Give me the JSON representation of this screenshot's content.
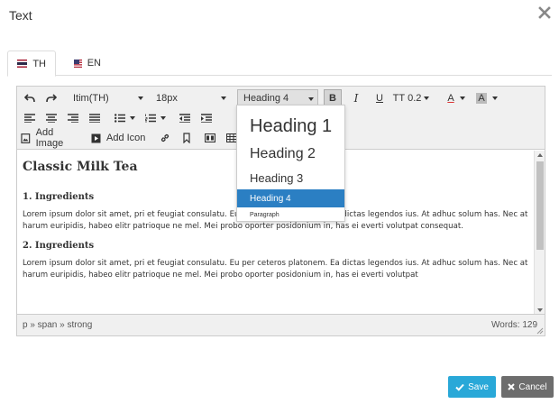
{
  "dialog": {
    "title": "Text"
  },
  "tabs": [
    {
      "label": "TH",
      "icon": "thai-flag-icon",
      "active": true
    },
    {
      "label": "EN",
      "icon": "us-flag-icon",
      "active": false
    }
  ],
  "toolbar": {
    "font_family": "Itim(TH)",
    "font_size": "18px",
    "format": "Heading 4",
    "line_height": "0.2",
    "add_image_label": "Add Image",
    "add_icon_label": "Add Icon",
    "text_color_label": "A",
    "bg_color_label": "A",
    "bold_label": "B",
    "italic_label": "I",
    "underline_label": "U",
    "line_height_label": "TT"
  },
  "format_dropdown": {
    "items": [
      "Heading 1",
      "Heading 2",
      "Heading 3",
      "Heading 4",
      "Paragraph"
    ],
    "selected": "Heading 4",
    "selected_color": "#2b7fc3"
  },
  "content": {
    "title": "Classic Milk Tea",
    "sections": [
      {
        "heading": "1. Ingredients",
        "body": "Lorem ipsum dolor sit amet, pri et feugiat consulatu. Eu per ceteros platonem. Ea dictas legendos ius. At adhuc solum has. Nec at harum euripidis, habeo elitr patrioque ne mel. Mei probo oporter posidonium in, has ei everti volutpat consequat."
      },
      {
        "heading": "2. Ingredients",
        "body": "Lorem ipsum dolor sit amet, pri et feugiat consulatu. Eu per ceteros platonem. Ea dictas legendos ius. At adhuc solum has. Nec at harum euripidis, habeo elitr patrioque ne mel. Mei probo oporter posidonium in, has ei everti volutpat"
      }
    ]
  },
  "statusbar": {
    "path": "p » span » strong",
    "words": "Words: 129"
  },
  "buttons": {
    "save": "Save",
    "cancel": "Cancel",
    "save_color": "#29a8d8",
    "cancel_color": "#6d6d6d"
  }
}
